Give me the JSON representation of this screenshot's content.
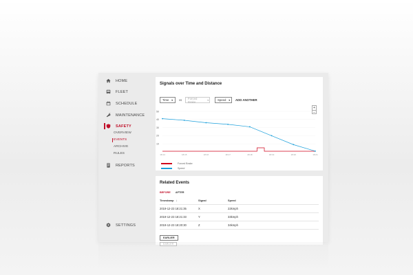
{
  "sidebar": {
    "items": [
      {
        "label": "HOME",
        "icon": "home-icon"
      },
      {
        "label": "FLEET",
        "icon": "bus-icon"
      },
      {
        "label": "SCHEDULE",
        "icon": "calendar-icon"
      },
      {
        "label": "MAINTENANCE",
        "icon": "wrench-icon"
      },
      {
        "label": "SAFETY",
        "icon": "shield-icon"
      },
      {
        "label": "REPORTS",
        "icon": "report-icon"
      }
    ],
    "safety_sub": [
      "OVERVIEW",
      "EVENTS",
      "ARCHIVE",
      "RULES"
    ],
    "settings_label": "SETTINGS"
  },
  "signals": {
    "title": "Signals over Time and Distance",
    "x_select": "Time",
    "vs": "vs",
    "y_select_1": "Forced Brake",
    "y_select_2": "Speed",
    "add_another": "ADD ANOTHER",
    "zoom_in": "+",
    "zoom_out": "−"
  },
  "chart_data": {
    "type": "line",
    "yticks": [
      10,
      20,
      30,
      40,
      50
    ],
    "ylim": [
      0,
      50
    ],
    "xticks": [
      "18:14",
      "18:15",
      "18:16",
      "18:17",
      "18:18",
      "18:19",
      "18:20",
      "18:21"
    ],
    "series": [
      {
        "name": "Forced Brake",
        "color": "#d0021b",
        "step": true,
        "values": [
          0,
          0,
          0,
          0,
          0,
          0,
          0,
          0,
          0,
          0,
          0,
          0,
          0,
          0,
          0,
          0,
          0,
          0,
          0,
          0,
          0,
          0,
          0,
          0,
          0,
          0,
          1,
          1,
          0,
          0,
          0,
          0,
          0,
          0,
          0,
          0,
          0,
          0,
          0,
          0,
          0,
          0
        ]
      },
      {
        "name": "Speed",
        "color": "#1a9fdb",
        "x": [
          0,
          1,
          2,
          3,
          4,
          5,
          6,
          7
        ],
        "values": [
          41,
          39,
          36,
          34,
          31,
          20,
          9,
          1
        ]
      }
    ]
  },
  "events": {
    "title": "Related Events",
    "tabs": [
      "BEFORE",
      "AFTER"
    ],
    "columns": [
      "Timestamp",
      "Signal",
      "Speed"
    ],
    "rows": [
      {
        "timestamp": "2019-12-23 18:21:35",
        "signal": "X",
        "speed": "22kmph"
      },
      {
        "timestamp": "2019-12-23 18:21:33",
        "signal": "Y",
        "speed": "33kmph"
      },
      {
        "timestamp": "2019-12-23 18:20:30",
        "signal": "Z",
        "speed": "34kmph"
      }
    ],
    "earlier_label": "EARLIER"
  },
  "colors": {
    "accent": "#c0102a",
    "speed": "#1a9fdb",
    "brake": "#d0021b"
  }
}
